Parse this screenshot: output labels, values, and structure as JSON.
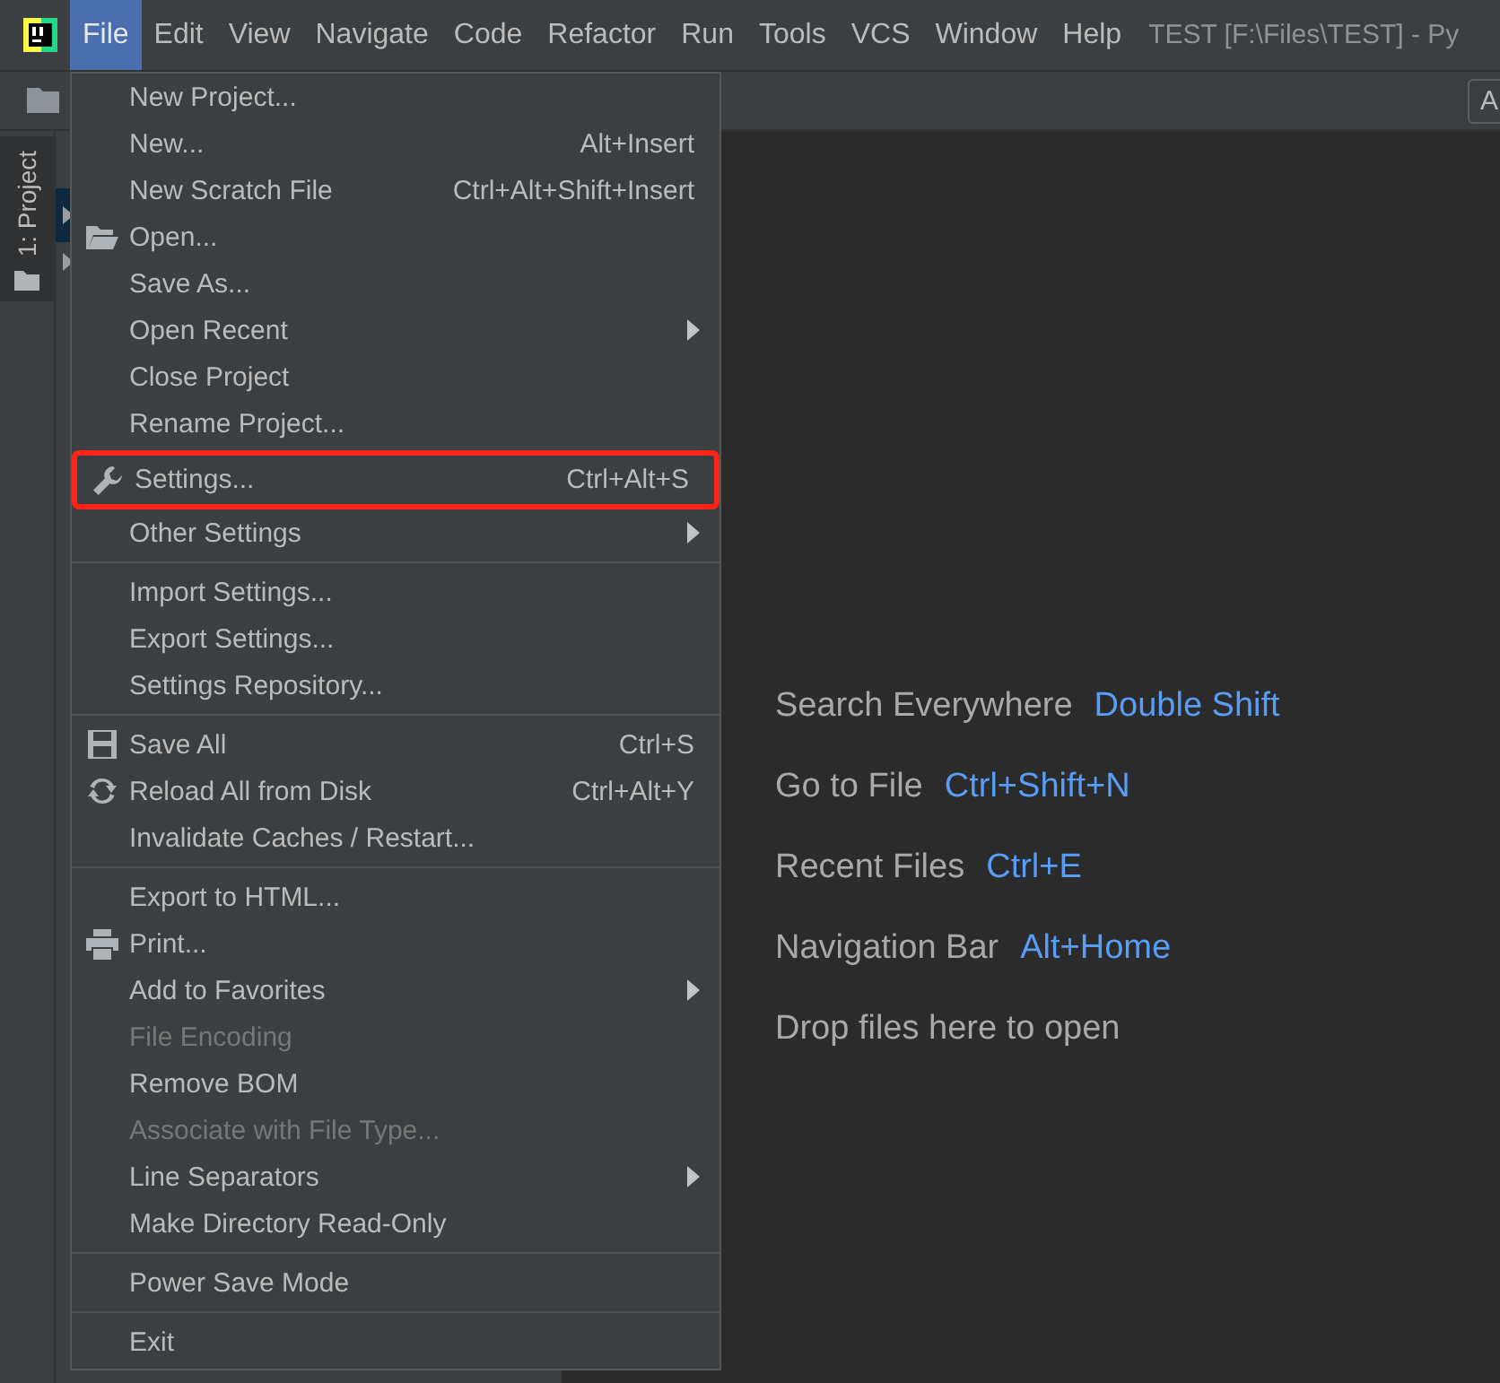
{
  "menubar": {
    "items": [
      {
        "label": "File",
        "selected": true
      },
      {
        "label": "Edit",
        "selected": false
      },
      {
        "label": "View",
        "selected": false
      },
      {
        "label": "Navigate",
        "selected": false
      },
      {
        "label": "Code",
        "selected": false
      },
      {
        "label": "Refactor",
        "selected": false
      },
      {
        "label": "Run",
        "selected": false
      },
      {
        "label": "Tools",
        "selected": false
      },
      {
        "label": "VCS",
        "selected": false
      },
      {
        "label": "Window",
        "selected": false
      },
      {
        "label": "Help",
        "selected": false
      }
    ],
    "title": "TEST [F:\\Files\\TEST] - Py"
  },
  "toolbar": {
    "right_button": "A"
  },
  "side_tab": {
    "label": "1: Project",
    "selected": true
  },
  "file_menu": {
    "items": [
      {
        "kind": "item",
        "label": "New Project..."
      },
      {
        "kind": "item",
        "label": "New...",
        "shortcut": "Alt+Insert"
      },
      {
        "kind": "item",
        "label": "New Scratch File",
        "shortcut": "Ctrl+Alt+Shift+Insert"
      },
      {
        "kind": "folder",
        "label": "Open..."
      },
      {
        "kind": "item",
        "label": "Save As..."
      },
      {
        "kind": "item",
        "label": "Open Recent",
        "submenu": true
      },
      {
        "kind": "item",
        "label": "Close Project"
      },
      {
        "kind": "item",
        "label": "Rename Project..."
      },
      {
        "kind": "wrench",
        "label": "Settings...",
        "shortcut": "Ctrl+Alt+S",
        "highlighted": true
      },
      {
        "kind": "item",
        "label": "Other Settings",
        "submenu": true
      },
      {
        "kind": "separator"
      },
      {
        "kind": "item",
        "label": "Import Settings..."
      },
      {
        "kind": "item",
        "label": "Export Settings..."
      },
      {
        "kind": "item",
        "label": "Settings Repository..."
      },
      {
        "kind": "separator"
      },
      {
        "kind": "save",
        "label": "Save All",
        "shortcut": "Ctrl+S"
      },
      {
        "kind": "reload",
        "label": "Reload All from Disk",
        "shortcut": "Ctrl+Alt+Y"
      },
      {
        "kind": "item",
        "label": "Invalidate Caches / Restart..."
      },
      {
        "kind": "separator"
      },
      {
        "kind": "item",
        "label": "Export to HTML..."
      },
      {
        "kind": "printer",
        "label": "Print..."
      },
      {
        "kind": "item",
        "label": "Add to Favorites",
        "submenu": true
      },
      {
        "kind": "item",
        "label": "File Encoding",
        "disabled": true
      },
      {
        "kind": "item",
        "label": "Remove BOM"
      },
      {
        "kind": "item",
        "label": "Associate with File Type...",
        "disabled": true
      },
      {
        "kind": "item",
        "label": "Line Separators",
        "submenu": true
      },
      {
        "kind": "item",
        "label": "Make Directory Read-Only"
      },
      {
        "kind": "separator"
      },
      {
        "kind": "item",
        "label": "Power Save Mode"
      },
      {
        "kind": "separator"
      },
      {
        "kind": "item",
        "label": "Exit"
      }
    ]
  },
  "editor_hints": [
    {
      "label": "Search Everywhere",
      "shortcut": "Double Shift"
    },
    {
      "label": "Go to File",
      "shortcut": "Ctrl+Shift+N"
    },
    {
      "label": "Recent Files",
      "shortcut": "Ctrl+E"
    },
    {
      "label": "Navigation Bar",
      "shortcut": "Alt+Home"
    },
    {
      "label": "Drop files here to open"
    }
  ]
}
